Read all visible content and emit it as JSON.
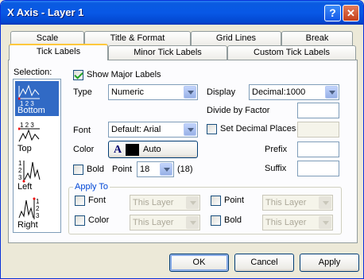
{
  "window": {
    "title": "X Axis - Layer 1",
    "help_glyph": "?",
    "close_glyph": "✕"
  },
  "tabs_back": [
    "Scale",
    "Title & Format",
    "Grid Lines",
    "Break"
  ],
  "tabs_front": [
    "Tick Labels",
    "Minor Tick Labels",
    "Custom Tick Labels"
  ],
  "selection": {
    "label": "Selection:",
    "items": [
      {
        "label": "Bottom",
        "icon": "bottom-axis-icon",
        "selected": true
      },
      {
        "label": "Top",
        "icon": "top-axis-icon",
        "selected": false
      },
      {
        "label": "Left",
        "icon": "left-axis-icon",
        "selected": false
      },
      {
        "label": "Right",
        "icon": "right-axis-icon",
        "selected": false
      }
    ]
  },
  "form": {
    "show_major_labels": {
      "label": "Show Major Labels",
      "checked": true
    },
    "type": {
      "label": "Type",
      "value": "Numeric"
    },
    "font": {
      "label": "Font",
      "value": "Default: Arial"
    },
    "color": {
      "label": "Color",
      "glyph": "A",
      "value": "Auto"
    },
    "bold": {
      "label": "Bold",
      "checked": false
    },
    "point": {
      "label": "Point",
      "value": "18",
      "extra": "(18)"
    },
    "display": {
      "label": "Display",
      "value": "Decimal:1000"
    },
    "divide_by_factor": {
      "label": "Divide by Factor",
      "value": ""
    },
    "set_decimal_places": {
      "label": "Set Decimal Places",
      "checked": false,
      "value": ""
    },
    "prefix": {
      "label": "Prefix",
      "value": ""
    },
    "suffix": {
      "label": "Suffix",
      "value": ""
    }
  },
  "apply_to": {
    "title": "Apply To",
    "font": {
      "label": "Font",
      "value": "This Layer"
    },
    "color": {
      "label": "Color",
      "value": "This Layer"
    },
    "point": {
      "label": "Point",
      "value": "This Layer"
    },
    "bold": {
      "label": "Bold",
      "value": "This Layer"
    }
  },
  "buttons": {
    "ok": "OK",
    "cancel": "Cancel",
    "apply": "Apply"
  },
  "colors": {
    "titlebar": "#0858e6",
    "accent_tab": "#ffc83c",
    "selection": "#316ac5",
    "group_title": "#0046d5"
  }
}
